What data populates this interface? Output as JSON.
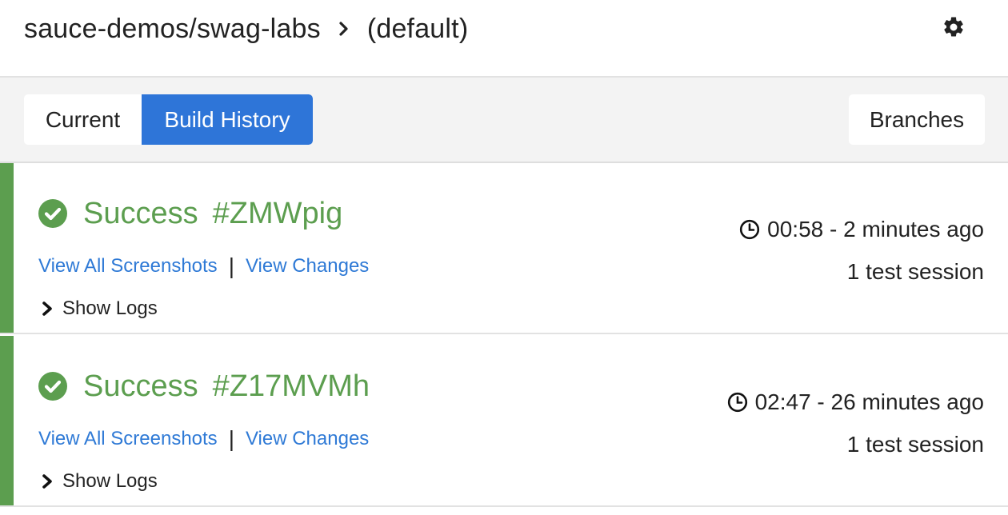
{
  "header": {
    "project": "sauce-demos/swag-labs",
    "branch": "(default)"
  },
  "tabs": {
    "current": "Current",
    "build_history": "Build History",
    "branches": "Branches"
  },
  "colors": {
    "accent": "#2e75d8",
    "success": "#5c9e4f",
    "link": "#2f7ad6"
  },
  "builds": [
    {
      "status": "Success",
      "id": "#ZMWpig",
      "view_screenshots": "View All Screenshots",
      "separator": "|",
      "view_changes": "View Changes",
      "show_logs": "Show Logs",
      "time": "00:58 - 2 minutes ago",
      "sessions": "1 test session"
    },
    {
      "status": "Success",
      "id": "#Z17MVMh",
      "view_screenshots": "View All Screenshots",
      "separator": "|",
      "view_changes": "View Changes",
      "show_logs": "Show Logs",
      "time": "02:47 - 26 minutes ago",
      "sessions": "1 test session"
    }
  ]
}
